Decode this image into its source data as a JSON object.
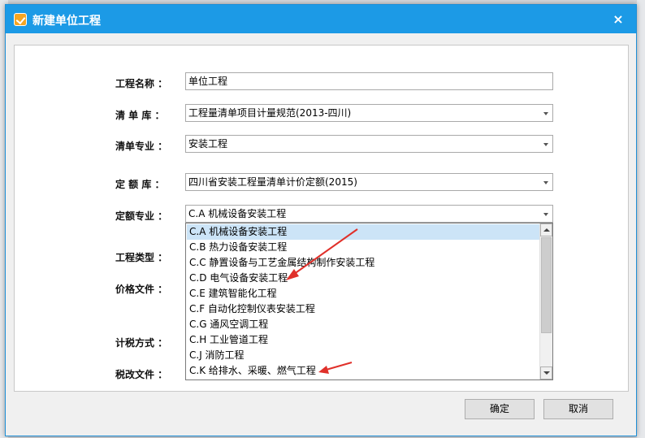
{
  "dialog": {
    "title": "新建单位工程",
    "close_glyph": "×"
  },
  "form": {
    "project_name": {
      "label": "工程名称 ：",
      "value": "单位工程"
    },
    "bill_library": {
      "label": "清 单 库 ：",
      "value": "工程量清单项目计量规范(2013-四川)"
    },
    "bill_major": {
      "label": "清单专业 ：",
      "value": "安装工程"
    },
    "quota_library": {
      "label": "定 额 库 ：",
      "value": "四川省安装工程量清单计价定额(2015)"
    },
    "quota_major": {
      "label": "定额专业 ：",
      "value": "C.A 机械设备安装工程"
    },
    "project_type": {
      "label": "工程类型 ："
    },
    "price_file": {
      "label": "价格文件 ："
    },
    "tax_method": {
      "label": "计税方式 ："
    },
    "tax_reform_file": {
      "label": "税改文件 ："
    }
  },
  "dropdown": {
    "selected_index": 0,
    "items": [
      "C.A 机械设备安装工程",
      "C.B 热力设备安装工程",
      "C.C 静置设备与工艺金属结构制作安装工程",
      "C.D 电气设备安装工程",
      "C.E 建筑智能化工程",
      "C.F 自动化控制仪表安装工程",
      "C.G 通风空调工程",
      "C.H 工业管道工程",
      "C.J 消防工程",
      "C.K 给排水、采暖、燃气工程"
    ]
  },
  "buttons": {
    "ok": "确定",
    "cancel": "取消"
  },
  "colors": {
    "titlebar": "#1c9ae6",
    "annotation_arrow": "#e0302a",
    "selection": "#cce4f7"
  },
  "icons": [
    "app-icon",
    "close-icon",
    "chevron-down-icon",
    "scroll-up-icon",
    "scroll-down-icon"
  ]
}
